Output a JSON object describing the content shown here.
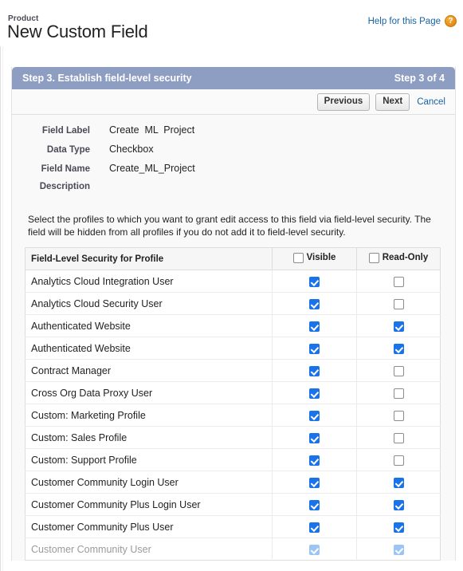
{
  "header": {
    "breadcrumb": "Product",
    "title": "New Custom Field",
    "help_label": "Help for this Page",
    "help_icon_glyph": "?",
    "help_icon_color": "#e8901a"
  },
  "step_bar": {
    "title": "Step 3. Establish field-level security",
    "counter": "Step 3 of 4",
    "background_color": "#8d9ec2"
  },
  "toolbar": {
    "previous_label": "Previous",
    "next_label": "Next",
    "cancel_label": "Cancel",
    "cancel_link_color": "#1763a6"
  },
  "field_details": [
    {
      "label": "Field Label",
      "value": "Create  ML  Project"
    },
    {
      "label": "Data Type",
      "value": "Checkbox"
    },
    {
      "label": "Field Name",
      "value": "Create_ML_Project"
    },
    {
      "label": "Description",
      "value": ""
    }
  ],
  "instructions": "Select the profiles to which you want to grant edit access to this field via field-level security. The field will be hidden from all profiles if you do not add it to field-level security.",
  "table": {
    "columns": {
      "profile": "Field-Level Security for Profile",
      "visible": "Visible",
      "read_only": "Read-Only"
    },
    "header_visible_checked": false,
    "header_read_only_checked": false,
    "checked_color": "#1a73e8",
    "rows": [
      {
        "profile": "Analytics Cloud Integration User",
        "visible": true,
        "read_only": false
      },
      {
        "profile": "Analytics Cloud Security User",
        "visible": true,
        "read_only": false
      },
      {
        "profile": "Authenticated Website",
        "visible": true,
        "read_only": true
      },
      {
        "profile": "Authenticated Website",
        "visible": true,
        "read_only": true
      },
      {
        "profile": "Contract Manager",
        "visible": true,
        "read_only": false
      },
      {
        "profile": "Cross Org Data Proxy User",
        "visible": true,
        "read_only": false
      },
      {
        "profile": "Custom: Marketing Profile",
        "visible": true,
        "read_only": false
      },
      {
        "profile": "Custom: Sales Profile",
        "visible": true,
        "read_only": false
      },
      {
        "profile": "Custom: Support Profile",
        "visible": true,
        "read_only": false
      },
      {
        "profile": "Customer Community Login User",
        "visible": true,
        "read_only": true
      },
      {
        "profile": "Customer Community Plus Login User",
        "visible": true,
        "read_only": true
      },
      {
        "profile": "Customer Community Plus User",
        "visible": true,
        "read_only": true
      },
      {
        "profile": "Customer Community User",
        "visible": true,
        "read_only": true,
        "clipped": true
      }
    ]
  }
}
